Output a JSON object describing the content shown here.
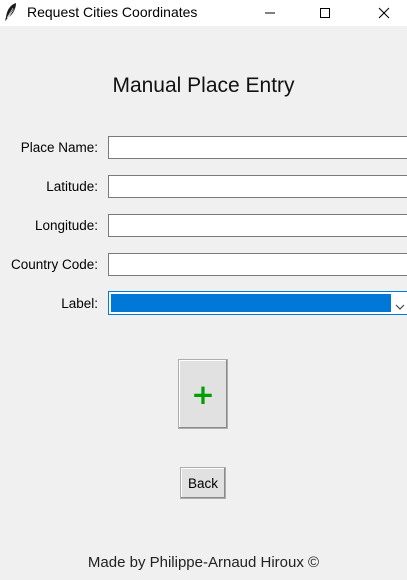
{
  "window": {
    "title": "Request Cities Coordinates"
  },
  "form": {
    "heading": "Manual Place Entry",
    "fields": [
      {
        "label": "Place Name:",
        "value": ""
      },
      {
        "label": "Latitude:",
        "value": ""
      },
      {
        "label": "Longitude:",
        "value": ""
      },
      {
        "label": "Country Code:",
        "value": ""
      }
    ],
    "label_field": {
      "label": "Label:",
      "value": ""
    }
  },
  "buttons": {
    "add_label": "+",
    "back_label": "Back"
  },
  "footer": {
    "text": "Made by Philippe-Arnaud Hiroux ©"
  },
  "colors": {
    "accent": "#0078d7",
    "add_icon": "#00a000"
  },
  "icons": {
    "app": "feather-icon",
    "minimize": "minimize-icon",
    "maximize": "maximize-icon",
    "close": "close-icon",
    "dropdown": "chevron-down-icon"
  }
}
